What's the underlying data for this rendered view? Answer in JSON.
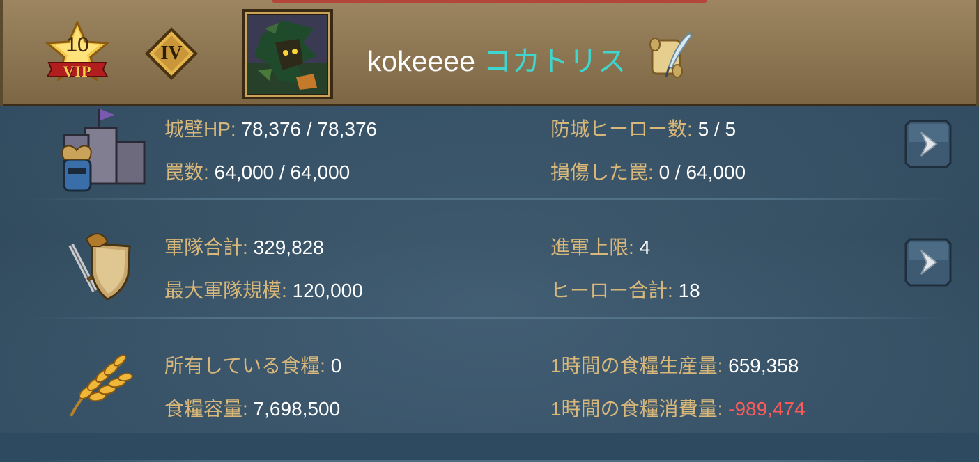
{
  "header": {
    "vip_level": "10",
    "vip_label": "VIP",
    "rank": "IV",
    "player_name": "kokeeee",
    "guild_name": "コカトリス",
    "icons": {
      "vip": "vip-star-icon",
      "rank": "rank-badge-icon",
      "avatar": "hero-portrait",
      "edit": "scroll-quill-icon"
    }
  },
  "sections": [
    {
      "icon": "castle-icon",
      "left": [
        {
          "label": "城壁HP",
          "value": "78,376 / 78,376"
        },
        {
          "label": "罠数",
          "value": "64,000 / 64,000"
        }
      ],
      "right": [
        {
          "label": "防城ヒーロー数",
          "value": "5 / 5"
        },
        {
          "label": "損傷した罠",
          "value": "0 / 64,000"
        }
      ],
      "has_arrow": true
    },
    {
      "icon": "sword-shield-icon",
      "left": [
        {
          "label": "軍隊合計",
          "value": "329,828"
        },
        {
          "label": "最大軍隊規模",
          "value": "120,000"
        }
      ],
      "right": [
        {
          "label": "進軍上限",
          "value": "4"
        },
        {
          "label": "ヒーロー合計",
          "value": "18"
        }
      ],
      "has_arrow": true
    },
    {
      "icon": "wheat-icon",
      "left": [
        {
          "label": "所有している食糧",
          "value": "0"
        },
        {
          "label": "食糧容量",
          "value": "7,698,500"
        }
      ],
      "right": [
        {
          "label": "1時間の食糧生産量",
          "value": "659,358"
        },
        {
          "label": "1時間の食糧消費量",
          "value": "-989,474"
        }
      ],
      "has_arrow": false
    }
  ],
  "colors": {
    "label": "#d7b77a",
    "value": "#ffffff",
    "negative": "#ff5a5a",
    "guild": "#3fd6d0",
    "header_bg": "#8a7350"
  }
}
